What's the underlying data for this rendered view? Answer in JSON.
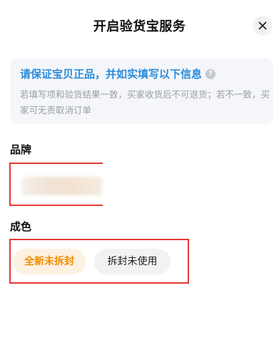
{
  "header": {
    "title": "开启验货宝服务"
  },
  "info": {
    "title": "请保证宝贝正品，并如实填写以下信息",
    "description": "若填写项和验货结果一致，买家收货后不可退货；若不一致，买家可无责取消订单"
  },
  "brand": {
    "label": "品牌"
  },
  "condition": {
    "label": "成色",
    "options": [
      {
        "label": "全新未拆封",
        "selected": true
      },
      {
        "label": "拆封未使用",
        "selected": false
      }
    ]
  },
  "colors": {
    "accent_blue": "#2b8cdb",
    "selected_orange": "#f08c00",
    "highlight_red": "#e53935"
  }
}
